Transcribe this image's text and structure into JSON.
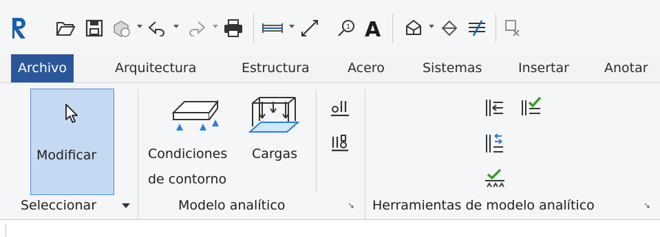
{
  "tabs": [
    "Archivo",
    "Arquitectura",
    "Estructura",
    "Acero",
    "Sistemas",
    "Insertar",
    "Anotar"
  ],
  "ribbon": {
    "modificar_label": "Modificar",
    "condiciones_label_1": "Condiciones",
    "condiciones_label_2": "de contorno",
    "cargas_label": "Cargas",
    "panel_select": "Seleccionar",
    "panel_modelo": "Modelo analítico",
    "panel_herramientas": "Herramientas de modelo analítico"
  },
  "icons": {
    "app": "revit-logo-icon",
    "open": "open-folder-icon",
    "save": "save-icon",
    "sync": "sync-central-icon",
    "undo": "undo-icon",
    "redo": "redo-icon",
    "print": "print-icon",
    "measure": "measure-icon",
    "aligned_dim": "aligned-dimension-icon",
    "tag": "tag-icon",
    "text": "text-icon",
    "view3d": "default-3d-view-icon",
    "section": "section-icon",
    "thin_lines": "thin-lines-icon",
    "close_hidden": "close-hidden-windows-icon"
  },
  "colors": {
    "accent": "#2b579a",
    "revit_blue": "#1b5fad",
    "selected_bg": "#c5daf2",
    "check_green": "#3c9a2c"
  }
}
